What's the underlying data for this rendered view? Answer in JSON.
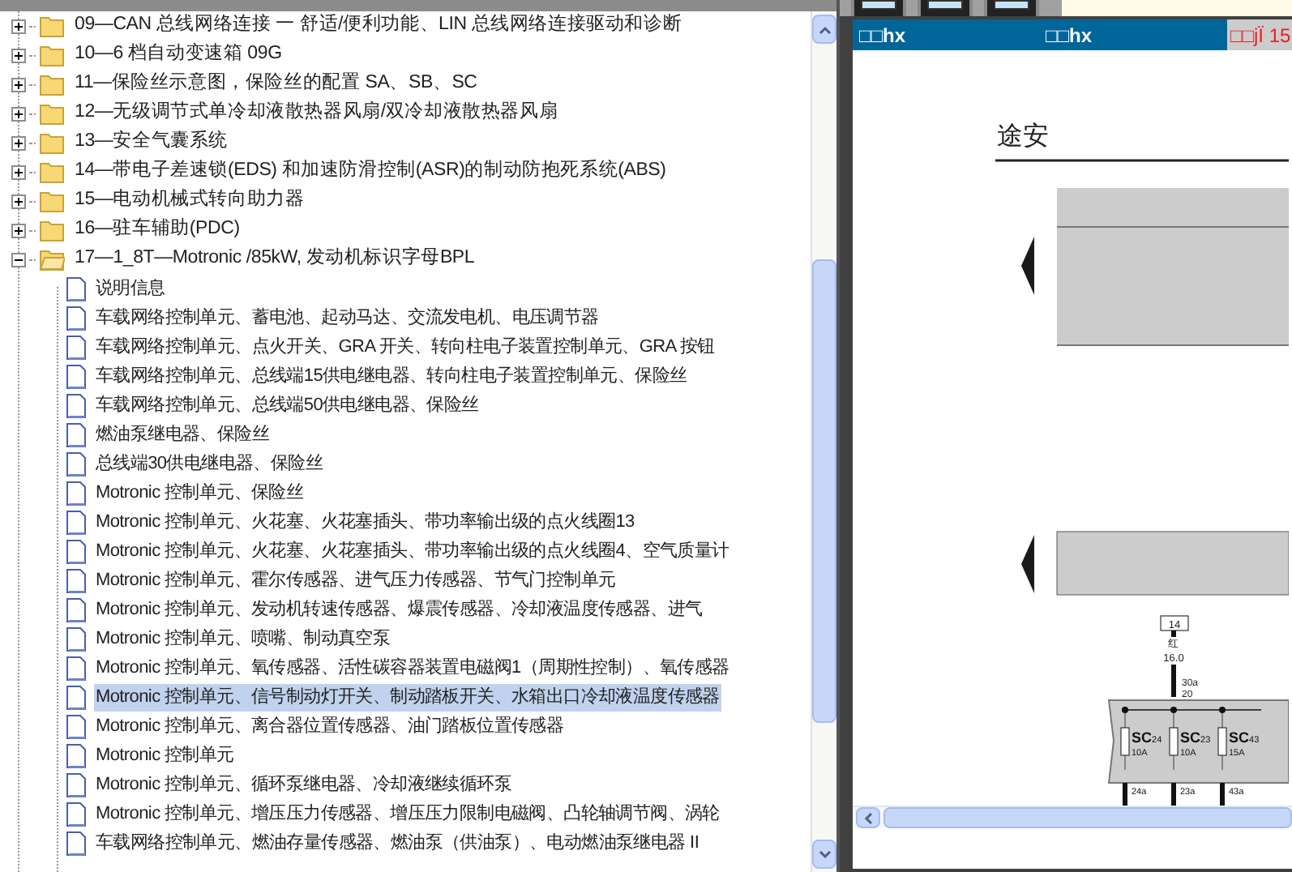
{
  "tree": {
    "items": [
      {
        "label": "09—CAN 总线网络连接 一 舒适/便利功能、LIN 总线网络连接驱动和诊断",
        "expanded": false
      },
      {
        "label": "10—6 档自动变速箱 09G",
        "expanded": false
      },
      {
        "label": "11—保险丝示意图，保险丝的配置 SA、SB、SC",
        "expanded": false
      },
      {
        "label": "12—无级调节式单冷却液散热器风扇/双冷却液散热器风扇",
        "expanded": false
      },
      {
        "label": "13—安全气囊系统",
        "expanded": false
      },
      {
        "label": "14—带电子差速锁(EDS) 和加速防滑控制(ASR)的制动防抱死系统(ABS)",
        "expanded": false
      },
      {
        "label": "15—电动机械式转向助力器",
        "expanded": false
      },
      {
        "label": "16—驻车辅助(PDC)",
        "expanded": false
      },
      {
        "label": "17—1_8T—Motronic /85kW, 发动机标识字母BPL",
        "expanded": true,
        "children": [
          {
            "label": "说明信息",
            "selected": false
          },
          {
            "label": "车载网络控制单元、蓄电池、起动马达、交流发电机、电压调节器",
            "selected": false
          },
          {
            "label": "车载网络控制单元、点火开关、GRA 开关、转向柱电子装置控制单元、GRA 按钮",
            "selected": false
          },
          {
            "label": "车载网络控制单元、总线端15供电继电器、转向柱电子装置控制单元、保险丝",
            "selected": false
          },
          {
            "label": "车载网络控制单元、总线端50供电继电器、保险丝",
            "selected": false
          },
          {
            "label": "燃油泵继电器、保险丝",
            "selected": false
          },
          {
            "label": "总线端30供电继电器、保险丝",
            "selected": false
          },
          {
            "label": "Motronic 控制单元、保险丝",
            "selected": false
          },
          {
            "label": "Motronic 控制单元、火花塞、火花塞插头、带功率输出级的点火线圈13",
            "selected": false
          },
          {
            "label": "Motronic 控制单元、火花塞、火花塞插头、带功率输出级的点火线圈4、空气质量计",
            "selected": false
          },
          {
            "label": "Motronic 控制单元、霍尔传感器、进气压力传感器、节气门控制单元",
            "selected": false
          },
          {
            "label": "Motronic 控制单元、发动机转速传感器、爆震传感器、冷却液温度传感器、进气",
            "selected": false
          },
          {
            "label": "Motronic 控制单元、喷嘴、制动真空泵",
            "selected": false
          },
          {
            "label": "Motronic 控制单元、氧传感器、活性碳容器装置电磁阀1（周期性控制）、氧传感器",
            "selected": false
          },
          {
            "label": "Motronic 控制单元、信号制动灯开关、制动踏板开关、水箱出口冷却液温度传感器",
            "selected": true
          },
          {
            "label": "Motronic 控制单元、离合器位置传感器、油门踏板位置传感器",
            "selected": false
          },
          {
            "label": "Motronic 控制单元",
            "selected": false
          },
          {
            "label": "Motronic 控制单元、循环泵继电器、冷却液继续循环泵",
            "selected": false
          },
          {
            "label": "Motronic 控制单元、增压压力传感器、增压压力限制电磁阀、凸轮轴调节阀、涡轮",
            "selected": false
          },
          {
            "label": "车载网络控制单元、燃油存量传感器、燃油泵（供油泵）、电动燃油泵继电器 II",
            "selected": false
          }
        ]
      }
    ]
  },
  "viewer": {
    "header": [
      "□□hx",
      "□□hx",
      "□□jÏ 15"
    ],
    "document": {
      "title": "途安",
      "connector": "14",
      "wire_color": "红",
      "wire_size": "16.0",
      "terminal": "30a",
      "terminal_number": "20",
      "fuses": [
        {
          "code": "SC",
          "index": "24",
          "rating": "10A",
          "terminal": "24a"
        },
        {
          "code": "SC",
          "index": "23",
          "rating": "10A",
          "terminal": "23a"
        },
        {
          "code": "SC",
          "index": "43",
          "rating": "15A",
          "terminal": "43a"
        }
      ]
    }
  }
}
